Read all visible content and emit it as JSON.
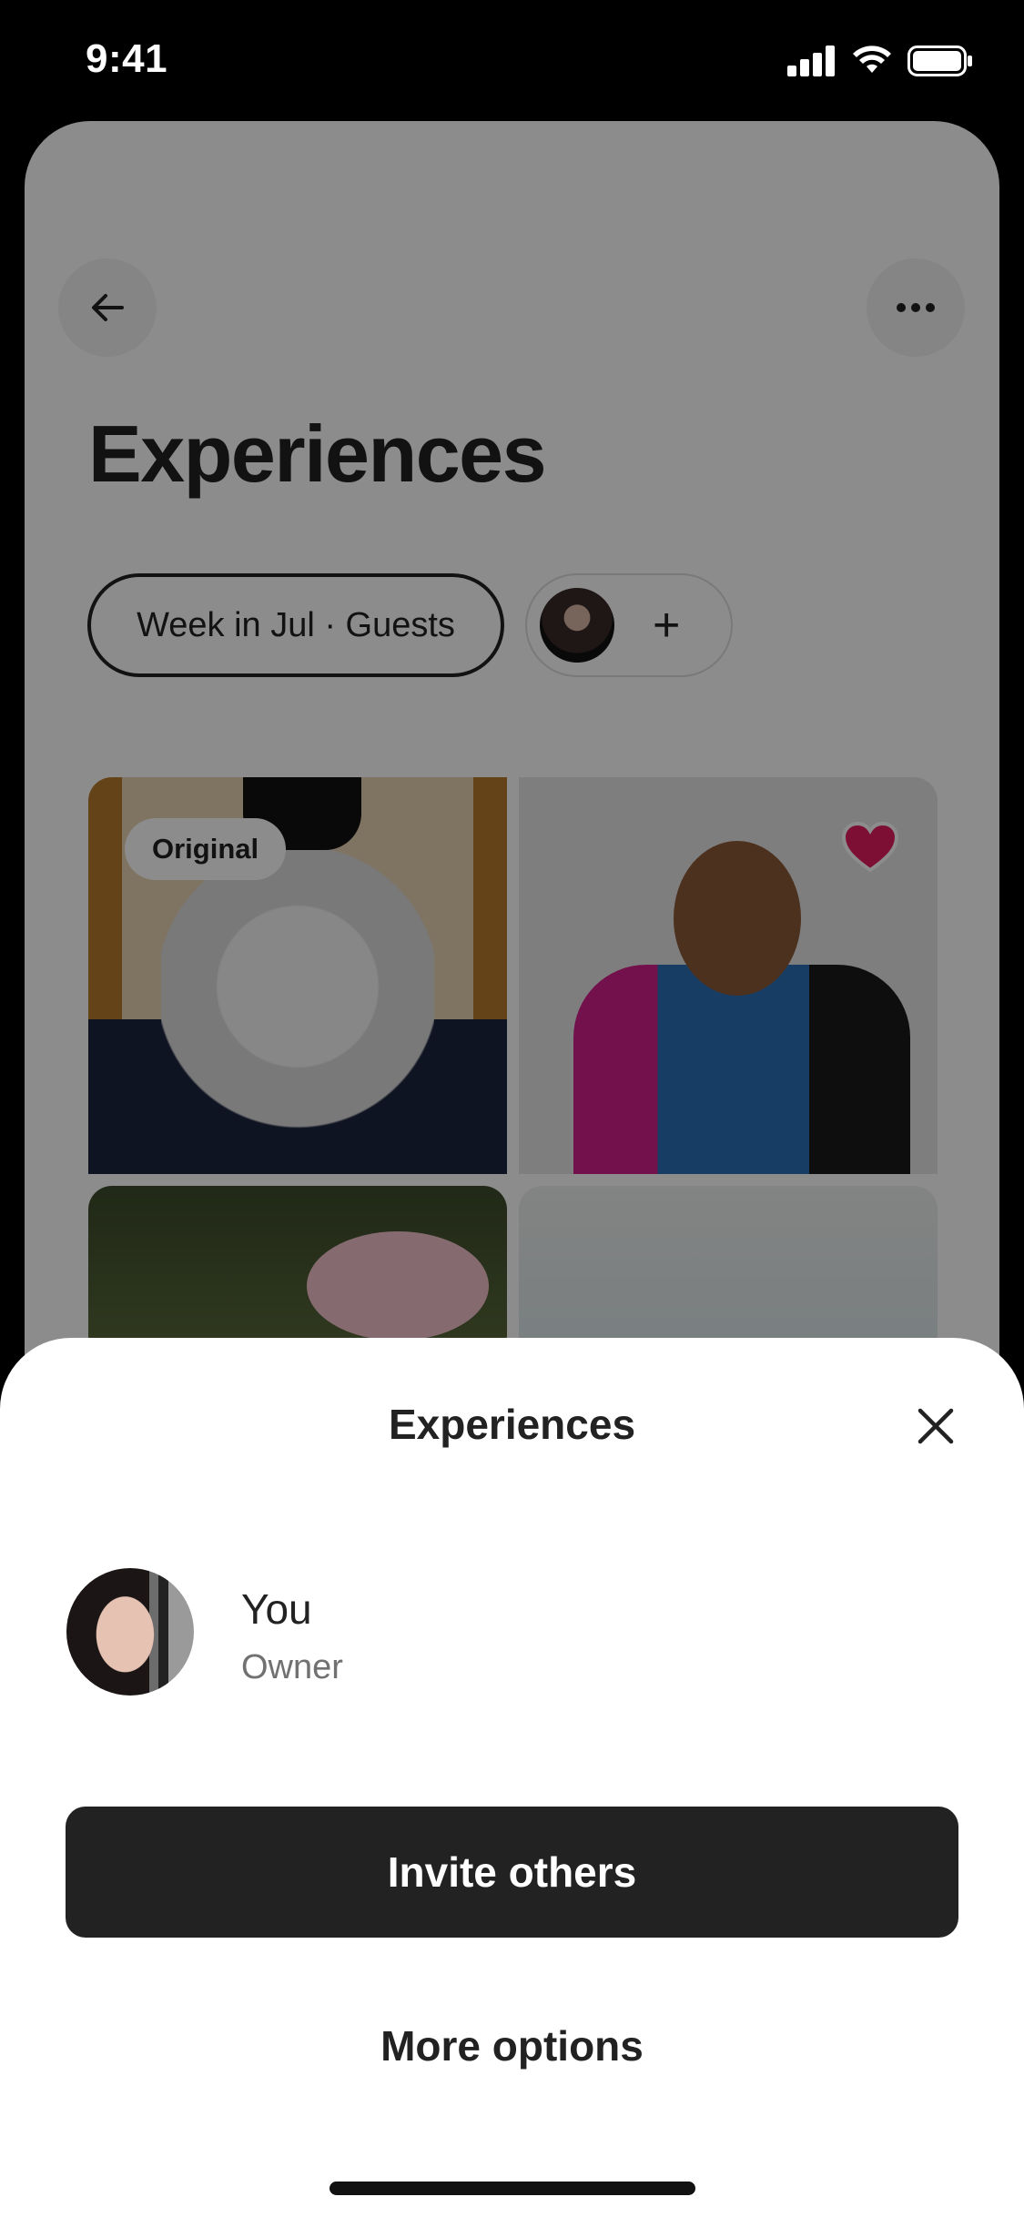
{
  "status_bar": {
    "time": "9:41"
  },
  "page": {
    "title": "Experiences",
    "filter_label": "Week in Jul · Guests",
    "add_people_symbol": "+",
    "tiles": [
      {
        "badge": "Original",
        "favorited": false
      },
      {
        "badge": "",
        "favorited": true
      },
      {
        "badge": "",
        "favorited": false
      },
      {
        "badge": "",
        "favorited": false
      }
    ]
  },
  "sheet": {
    "title": "Experiences",
    "members": [
      {
        "name": "You",
        "role": "Owner"
      }
    ],
    "primary_button": "Invite others",
    "secondary_button": "More options"
  },
  "colors": {
    "primary": "#222222",
    "secondary_text": "#717171",
    "heart": "#e31c5f",
    "overlay": "rgba(0,0,0,0.45)"
  },
  "icons": {
    "back": "arrow-left-icon",
    "more": "ellipsis-icon",
    "close": "close-icon",
    "favorite": "heart-icon",
    "signal": "cellular-signal-icon",
    "wifi": "wifi-icon",
    "battery": "battery-icon"
  }
}
